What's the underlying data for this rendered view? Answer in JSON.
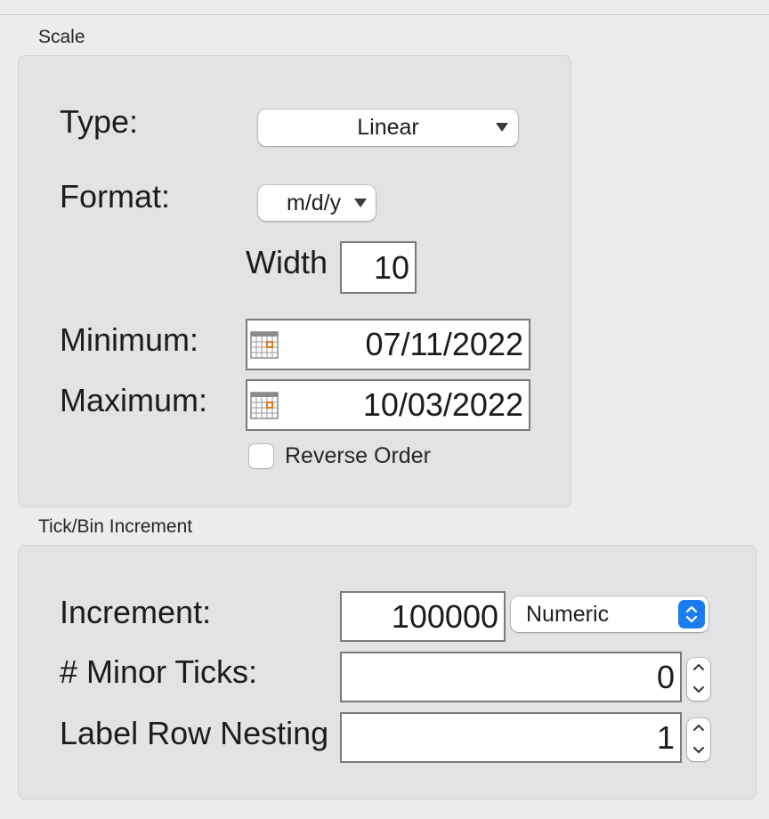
{
  "scale": {
    "group_title": "Scale",
    "type_label": "Type:",
    "type_value": "Linear",
    "format_label": "Format:",
    "format_value": "m/d/y",
    "width_label": "Width",
    "width_value": "10",
    "minimum_label": "Minimum:",
    "minimum_value": "07/11/2022",
    "maximum_label": "Maximum:",
    "maximum_value": "10/03/2022",
    "reverse_order_label": "Reverse Order",
    "reverse_order_checked": false
  },
  "tick": {
    "group_title": "Tick/Bin Increment",
    "increment_label": "Increment:",
    "increment_value": "100000",
    "increment_unit": "Numeric",
    "minor_ticks_label": "# Minor Ticks:",
    "minor_ticks_value": "0",
    "label_row_nesting_label": "Label Row Nesting",
    "label_row_nesting_value": "1"
  },
  "icons": {
    "calendar": "calendar-icon",
    "dropdown": "triangle-down-icon",
    "stepper": "up-down-chevron-icon"
  },
  "colors": {
    "accent": "#1a7cf0",
    "calendar_highlight": "#e07a1c",
    "panel": "#e3e3e6"
  }
}
